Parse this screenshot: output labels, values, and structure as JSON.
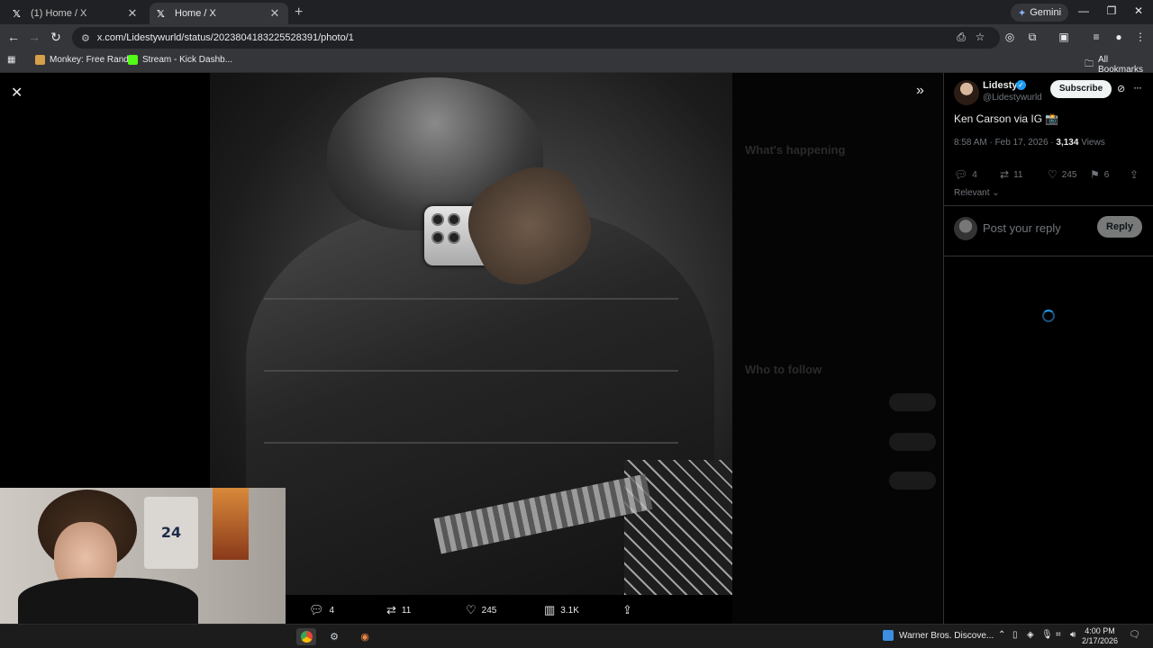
{
  "browser": {
    "tabs": [
      {
        "title": "(1) Home / X",
        "active": false
      },
      {
        "title": "Home / X",
        "active": true
      }
    ],
    "gemini_label": "Gemini",
    "url": "x.com/Lidestywurld/status/2023804183225528391/photo/1",
    "bookmarks": [
      {
        "label": "Monkey: Free Rand..."
      },
      {
        "label": "Stream - Kick Dashb..."
      }
    ],
    "all_bookmarks_label": "All Bookmarks"
  },
  "viewer": {
    "actions": {
      "replies": "4",
      "reposts": "11",
      "likes": "245",
      "views": "3.1K"
    }
  },
  "post": {
    "author_name": "Lidesty",
    "author_handle": "@Lidestywurld",
    "subscribe_label": "Subscribe",
    "text": "Ken Carson via IG 📸",
    "time": "8:58 AM · Feb 17, 2026 · ",
    "views_count": "3,134",
    "views_label": " Views",
    "stats": {
      "replies": "4",
      "reposts": "11",
      "likes": "245",
      "bookmarks": "6"
    },
    "sort_label": "Relevant",
    "reply_placeholder": "Post your reply",
    "reply_button": "Reply"
  },
  "webcam": {
    "jersey_number": "24"
  },
  "taskbar": {
    "news_text": "Warner Bros. Discove...",
    "time": "4:00 PM",
    "date": "2/17/2026"
  },
  "colors": {
    "accent": "#1d9bf0",
    "background": "#000000",
    "text": "#e7e9ea",
    "muted": "#71767b"
  }
}
